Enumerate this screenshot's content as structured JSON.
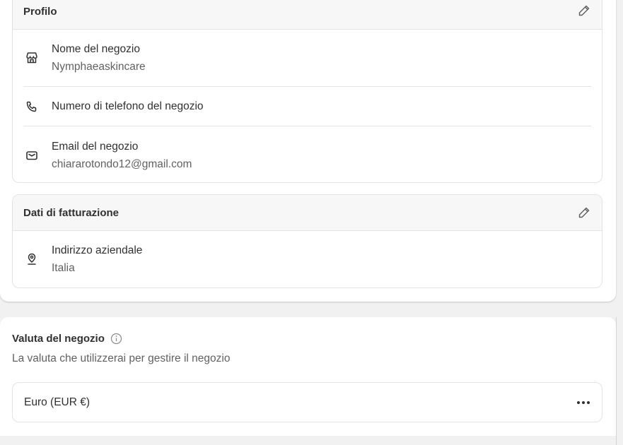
{
  "profile": {
    "title": "Profilo",
    "items": [
      {
        "icon": "store-icon",
        "label": "Nome del negozio",
        "value": "Nymphaeaskincare"
      },
      {
        "icon": "phone-icon",
        "label": "Numero di telefono del negozio"
      },
      {
        "icon": "email-icon",
        "label": "Email del negozio",
        "value": "chiararotondo12@gmail.com"
      }
    ]
  },
  "billing": {
    "title": "Dati di fatturazione",
    "items": [
      {
        "icon": "location-icon",
        "label": "Indirizzo aziendale",
        "value": "Italia"
      }
    ]
  },
  "currency": {
    "title": "Valuta del negozio",
    "subtitle": "La valuta che utilizzerai per gestire il negozio",
    "value": "Euro (EUR €)"
  }
}
